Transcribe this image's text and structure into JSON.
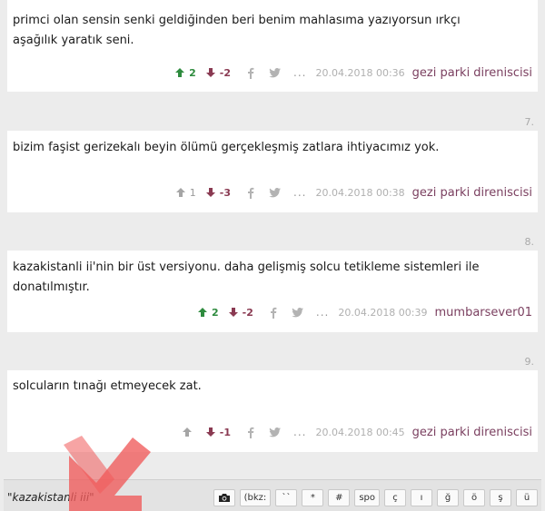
{
  "entries": [
    {
      "number": "",
      "text": "primci olan sensin senki geldiğinden beri benim mahlasıma yazıyorsun ırkçı aşağılık yaratık seni.",
      "upvotes": "2",
      "downvotes": "-2",
      "date": "20.04.2018 00:36",
      "author": "gezi parki direniscisi"
    },
    {
      "number": "7.",
      "text": "bizim faşist gerizekalı beyin ölümü gerçekleşmiş zatlara ihtiyacımız yok.",
      "upvotes": "1",
      "downvotes": "-3",
      "date": "20.04.2018 00:38",
      "author": "gezi parki direniscisi"
    },
    {
      "number": "8.",
      "text": "kazakistanli ii'nin bir üst versiyonu. daha gelişmiş solcu tetikleme sistemleri ile donatılmıştır.",
      "upvotes": "2",
      "downvotes": "-2",
      "date": "20.04.2018 00:39",
      "author": "mumbarsever01"
    },
    {
      "number": "9.",
      "text": "solcuların tınağı etmeyecek zat.",
      "upvotes": "",
      "downvotes": "-1",
      "date": "20.04.2018 00:45",
      "author": "gezi parki direniscisi"
    }
  ],
  "actions": {
    "more": "..."
  },
  "editor": {
    "draft": "\"kazakistanli iii\"",
    "buttons": [
      "(bkz:",
      "``",
      "*",
      "#",
      "spo",
      "ç",
      "ı",
      "ğ",
      "ö",
      "ş",
      "ü"
    ]
  },
  "colors": {
    "upvote": "#2e8b3e",
    "downvote": "#8a3a52",
    "author": "#7b4060",
    "overlay_arrow": "#f05a5a"
  }
}
